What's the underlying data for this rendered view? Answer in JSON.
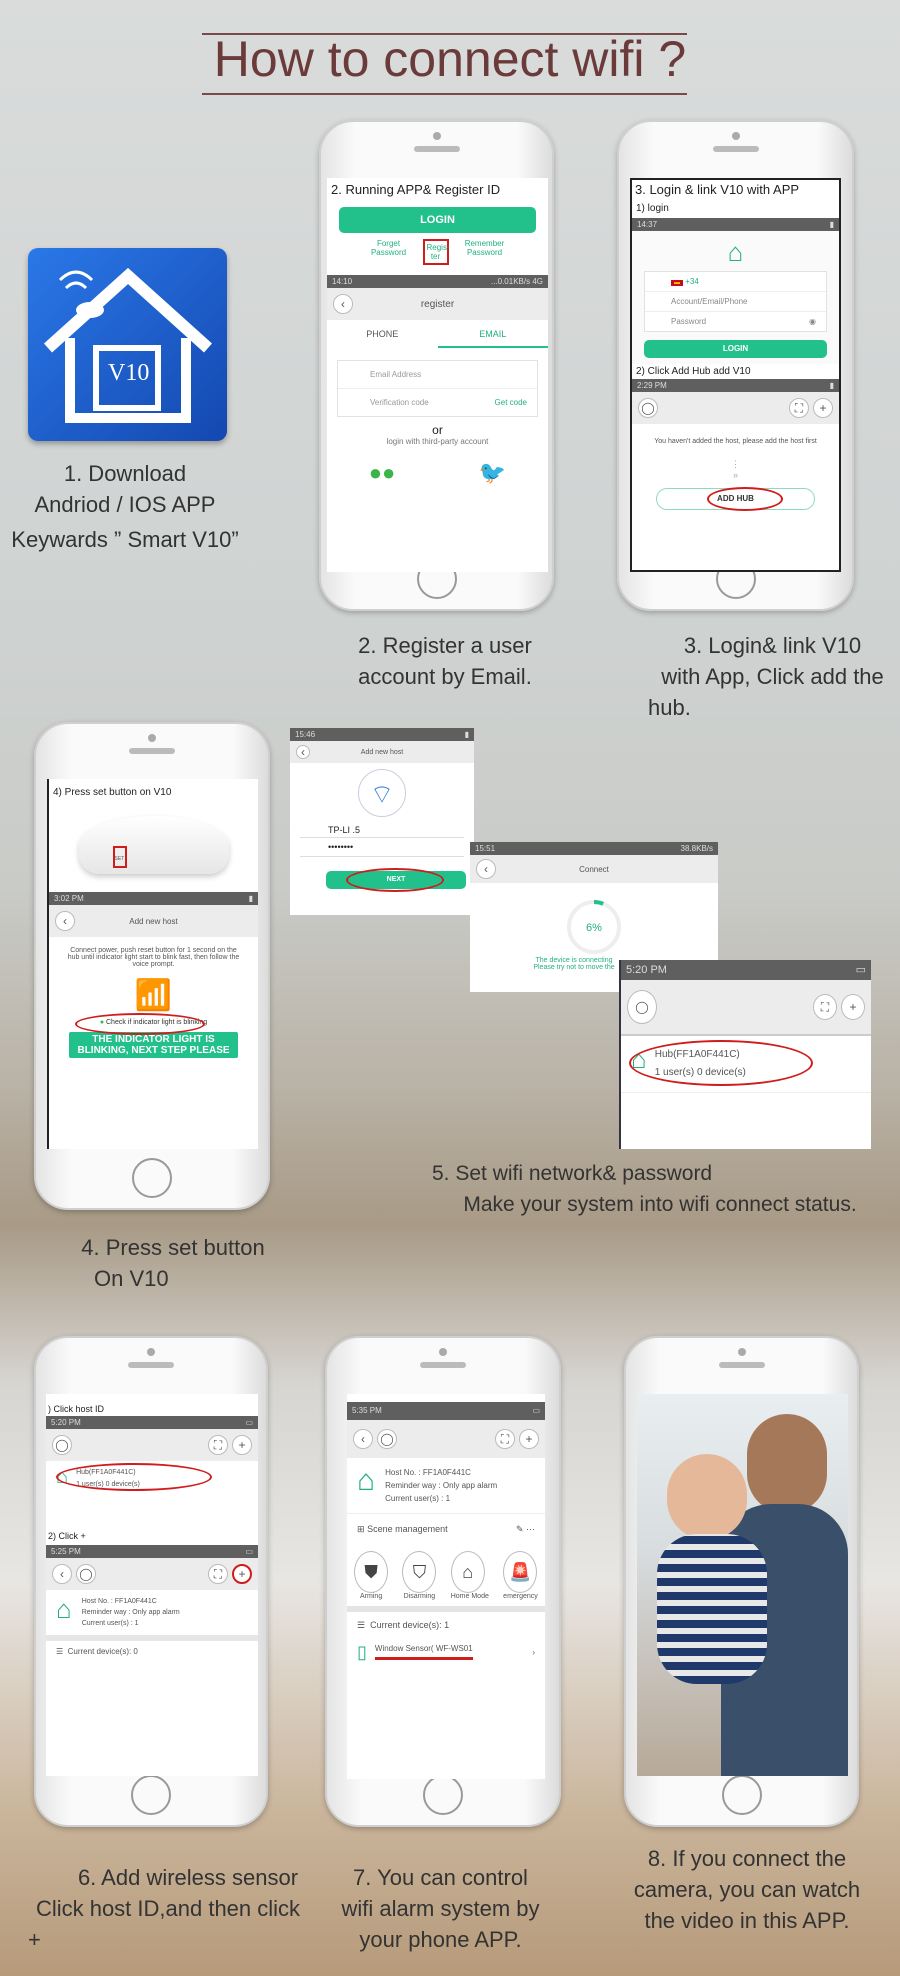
{
  "title": "How to connect wifi ?",
  "steps": {
    "s1": [
      "1. Download",
      "Andriod / IOS APP",
      "Keywards ” Smart V10”"
    ],
    "s2": [
      "2. Register a user",
      "account by Email."
    ],
    "s3": [
      "3. Login& link V10",
      "with App, Click add the",
      "hub."
    ],
    "s4": [
      "4. Press set button",
      "On V10"
    ],
    "s5": [
      "5. Set wifi network& password",
      "Make your system into wifi connect status."
    ],
    "s6": [
      "6. Add wireless sensor",
      "Click host ID,and then click",
      "+"
    ],
    "s7": [
      "7. You can control",
      "wifi alarm system by",
      "your phone APP."
    ],
    "s8": [
      "8. If you connect the",
      "camera, you can watch",
      "the video in this APP."
    ]
  },
  "app_icon": {
    "text": "V10",
    "color": "#1e5fd0"
  },
  "p2": {
    "header": "2. Running APP& Register ID",
    "login": "LOGIN",
    "forget": "Forget Password",
    "register": "Regis- ter",
    "remember": "Remember Password",
    "status_time": "14:10",
    "status_right": "...0.01KB/s 4G",
    "nav_title": "register",
    "tab_phone": "PHONE",
    "tab_email": "EMAIL",
    "email_ph": "Email Address",
    "code_ph": "Verification code",
    "get_code": "Get code",
    "or": "or",
    "third": "login with third-party account"
  },
  "p3": {
    "header": "3. Login & link V10 with APP",
    "sub1": "1) login",
    "status_time": "14:37",
    "country_code": "+34",
    "account_ph": "Account/Email/Phone",
    "password_ph": "Password",
    "login": "LOGIN",
    "sub2": "2) Click Add Hub add V10",
    "status_time2": "2:29 PM",
    "empty_msg": "You haven't added the host, please add the host first",
    "add_hub": "ADD HUB"
  },
  "p4": {
    "header": "4) Press set button on V10",
    "set_label": "SET",
    "status_time": "3:02 PM",
    "nav_title": "Add new host",
    "instructions": "Connect power, push reset button for 1 second on the hub until indicator light start to blink fast, then follow the voice prompt.",
    "check": "Check if indicator light is blinking",
    "button": "THE INDICATOR LIGHT IS BLINKING, NEXT STEP PLEASE"
  },
  "s5a": {
    "status_time": "15:46",
    "nav_title": "Add new host",
    "ssid": "TP-LI      .5",
    "password": "••••••••",
    "next": "NEXT"
  },
  "s5b": {
    "status_time": "15:51",
    "status_right": "38.8KB/s",
    "nav_title": "Connect",
    "progress": "6%",
    "progress_value": 6,
    "msg1": "The device is connecting",
    "msg2": "Please try not to move the"
  },
  "s5c": {
    "status_time": "5:20 PM",
    "hub": "Hub(FF1A0F441C)",
    "counts": "1 user(s)  0 device(s)"
  },
  "p6": {
    "sub1": ") Click host ID",
    "time1": "5:20 PM",
    "hub": "Hub(FF1A0F441C)",
    "counts": "1 user(s)  0 device(s)",
    "sub2": "2) Click +",
    "time2": "5:25 PM",
    "host_no": "Host No. :  FF1A0F441C",
    "reminder": "Reminder way :  Only app alarm",
    "users": "Current user(s) :  1",
    "devices": "Current device(s):  0"
  },
  "p7": {
    "time": "5:35 PM",
    "host_no": "Host No. :  FF1A0F441C",
    "reminder": "Reminder way :  Only app alarm",
    "users": "Current user(s) :  1",
    "scene": "Scene management",
    "modes": [
      "Arming",
      "Disarming",
      "Home Mode",
      "emergency"
    ],
    "devices": "Current device(s):  1",
    "sensor": "Window Sensor( WF-WS01"
  }
}
